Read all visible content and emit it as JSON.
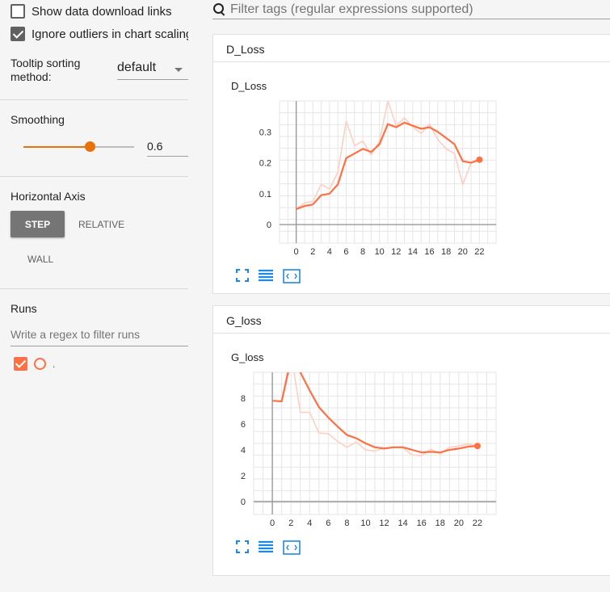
{
  "sidebar": {
    "show_download": "Show data download links",
    "ignore_outliers": "Ignore outliers in chart scaling",
    "tooltip_label": "Tooltip sorting method:",
    "tooltip_value": "default",
    "smoothing_title": "Smoothing",
    "smoothing_value": "0.6",
    "smoothing_fraction": 0.6,
    "horizontal_axis_title": "Horizontal Axis",
    "axis_step": "STEP",
    "axis_relative": "RELATIVE",
    "axis_wall": "WALL",
    "runs_title": "Runs",
    "runs_placeholder": "Write a regex to filter runs",
    "run_name": "."
  },
  "filter": {
    "placeholder": "Filter tags (regular expressions supported)"
  },
  "colors": {
    "accent": "#e8710a",
    "series": "#ff7043",
    "raw": "#ffcfc2"
  },
  "icons": [
    "fit-to-screen-icon",
    "toggle-lines-icon",
    "fit-domain-icon"
  ],
  "cards": [
    {
      "header": "D_Loss",
      "chart_data": {
        "type": "line",
        "title": "D_Loss",
        "x_ticks": [
          "0",
          "2",
          "4",
          "6",
          "8",
          "10",
          "12",
          "14",
          "16",
          "18",
          "20",
          "22"
        ],
        "y_ticks": [
          "0",
          "0.1",
          "0.2",
          "0.3"
        ],
        "xlim": [
          -2,
          24
        ],
        "ylim": [
          -0.06,
          0.4
        ],
        "x": [
          0,
          1,
          2,
          3,
          4,
          5,
          6,
          7,
          8,
          9,
          10,
          11,
          12,
          13,
          14,
          15,
          16,
          17,
          18,
          19,
          20,
          21,
          22
        ],
        "series": [
          {
            "values": [
              0.05,
              0.06,
              0.065,
              0.095,
              0.1,
              0.13,
              0.215,
              0.23,
              0.245,
              0.235,
              0.26,
              0.325,
              0.315,
              0.33,
              0.32,
              0.31,
              0.315,
              0.3,
              0.28,
              0.26,
              0.205,
              0.2,
              0.21
            ]
          },
          {
            "values": [
              0.05,
              0.07,
              0.075,
              0.13,
              0.115,
              0.17,
              0.335,
              0.255,
              0.27,
              0.225,
              0.27,
              0.4,
              0.32,
              0.345,
              0.315,
              0.295,
              0.325,
              0.275,
              0.245,
              0.23,
              0.13,
              0.2,
              0.21
            ]
          }
        ]
      }
    },
    {
      "header": "G_loss",
      "chart_data": {
        "type": "line",
        "title": "G_loss",
        "x_ticks": [
          "0",
          "2",
          "4",
          "6",
          "8",
          "10",
          "12",
          "14",
          "16",
          "18",
          "20",
          "22"
        ],
        "y_ticks": [
          "0",
          "2",
          "4",
          "6",
          "8"
        ],
        "xlim": [
          -2,
          24
        ],
        "ylim": [
          -1,
          10
        ],
        "x": [
          0,
          1,
          2,
          3,
          4,
          5,
          6,
          7,
          8,
          9,
          10,
          11,
          12,
          13,
          14,
          15,
          16,
          17,
          18,
          19,
          20,
          21,
          22
        ],
        "series": [
          {
            "values": [
              7.8,
              7.75,
              11,
              10,
              8.6,
              7.3,
              6.5,
              5.8,
              5.15,
              4.9,
              4.5,
              4.2,
              4.1,
              4.2,
              4.2,
              4.0,
              3.8,
              3.85,
              3.8,
              4.0,
              4.1,
              4.25,
              4.3
            ]
          },
          {
            "values": [
              7.8,
              7.75,
              11.5,
              6.9,
              6.9,
              5.3,
              5.25,
              4.65,
              4.2,
              4.6,
              4.0,
              3.9,
              4.15,
              4.2,
              4.15,
              3.6,
              3.55,
              4.05,
              3.7,
              4.2,
              4.3,
              4.45,
              4.3
            ]
          }
        ]
      }
    }
  ]
}
